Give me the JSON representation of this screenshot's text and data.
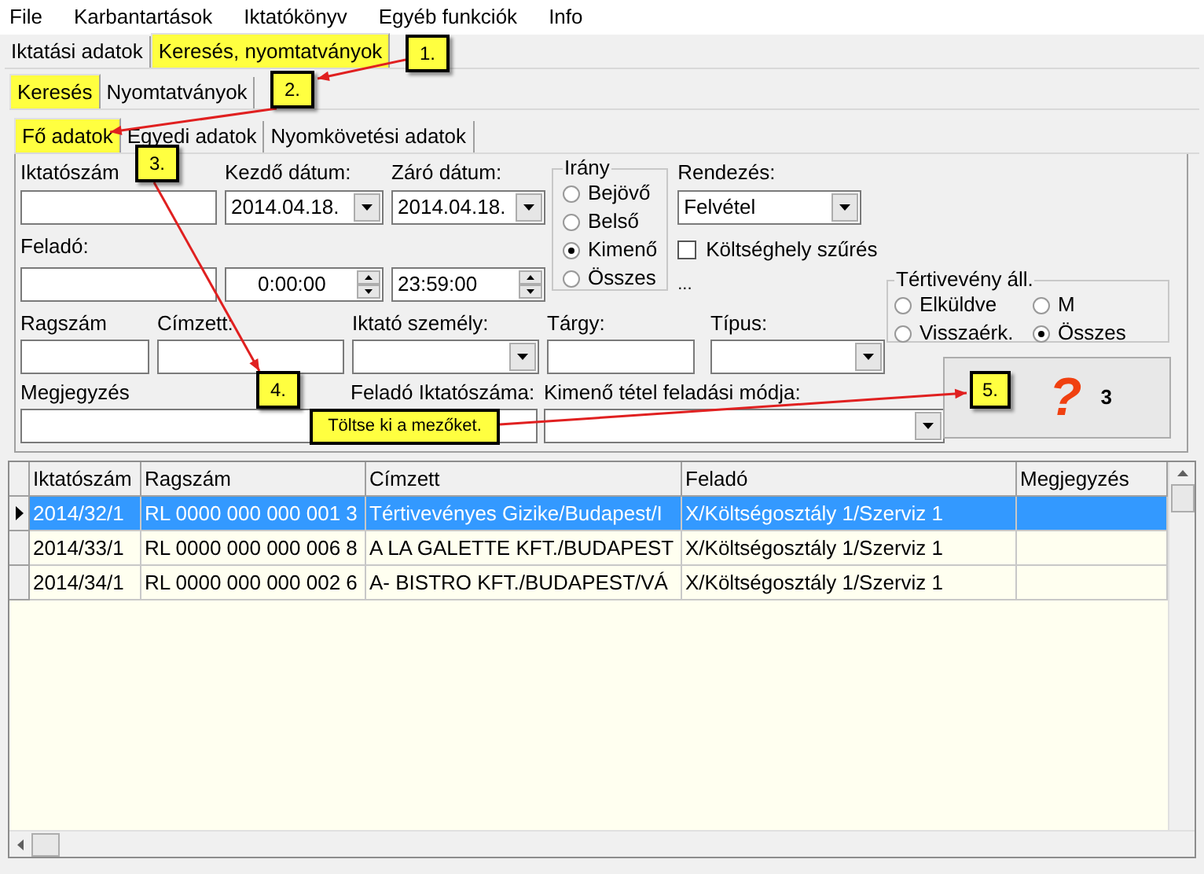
{
  "menu": [
    "File",
    "Karbantartások",
    "Iktatókönyv",
    "Egyéb funkciók",
    "Info"
  ],
  "tabs_main": [
    {
      "label": "Iktatási adatok",
      "selected": false,
      "highlighted": false
    },
    {
      "label": "Keresés, nyomtatványok",
      "selected": true,
      "highlighted": true
    }
  ],
  "tabs_sub": [
    {
      "label": "Keresés",
      "selected": true,
      "highlighted": true
    },
    {
      "label": "Nyomtatványok",
      "selected": false,
      "highlighted": false
    }
  ],
  "tabs_form": [
    {
      "label": "Fő adatok",
      "selected": true,
      "highlighted": true
    },
    {
      "label": "Egyedi adatok",
      "selected": false,
      "highlighted": false
    },
    {
      "label": "Nyomkövetési adatok",
      "selected": false,
      "highlighted": false
    }
  ],
  "form": {
    "iktatoszam": {
      "label": "Iktatószám"
    },
    "kezdo_datum": {
      "label": "Kezdő dátum:",
      "value": "2014.04.18."
    },
    "zaro_datum": {
      "label": "Záró dátum:",
      "value": "2014.04.18."
    },
    "felado": {
      "label": "Feladó:"
    },
    "kezdo_ido": {
      "value": "0:00:00"
    },
    "zaro_ido": {
      "value": "23:59:00"
    },
    "irany": {
      "title": "Irány",
      "options": [
        {
          "label": "Bejövő",
          "selected": false
        },
        {
          "label": "Belső",
          "selected": false
        },
        {
          "label": "Kimenő",
          "selected": true
        },
        {
          "label": "Összes",
          "selected": false
        }
      ]
    },
    "rendezes": {
      "label": "Rendezés:",
      "value": "Felvétel"
    },
    "koltseghely": {
      "label": "Költséghely szűrés",
      "checked": false
    },
    "more": "...",
    "tertiveveny": {
      "title": "Tértivevény áll.",
      "options": [
        {
          "label": "Elküldve",
          "selected": false
        },
        {
          "label": "M",
          "selected": false
        },
        {
          "label": "Visszaérk.",
          "selected": false
        },
        {
          "label": "Összes",
          "selected": true
        }
      ]
    },
    "ragszam": {
      "label": "Ragszám"
    },
    "cimzett": {
      "label": "Címzett:"
    },
    "iktato_szemely": {
      "label": "Iktató személy:"
    },
    "targy": {
      "label": "Tárgy:"
    },
    "tipus": {
      "label": "Típus:"
    },
    "megjegyzes": {
      "label": "Megjegyzés"
    },
    "felado_iktatoszama": {
      "label": "Feladó Iktatószáma:"
    },
    "feladasi_mod": {
      "label": "Kimenő tétel feladási módja:"
    },
    "search_button": {
      "icon": "?",
      "count": "3"
    }
  },
  "grid": {
    "columns": [
      "Iktatószám",
      "Ragszám",
      "Címzett",
      "Feladó",
      "Megjegyzés"
    ],
    "rows": [
      {
        "selected": true,
        "cells": [
          "2014/32/1",
          "RL 0000 000 000 001 3",
          "Tértivevényes Gizike/Budapest/I",
          "X/Költségosztály 1/Szerviz 1",
          ""
        ]
      },
      {
        "selected": false,
        "cells": [
          "2014/33/1",
          "RL 0000 000 000 006 8",
          "A LA GALETTE KFT./BUDAPEST",
          "X/Költségosztály 1/Szerviz 1",
          ""
        ]
      },
      {
        "selected": false,
        "cells": [
          "2014/34/1",
          "RL 0000 000 000 002 6",
          "A- BISTRO KFT./BUDAPEST/VÁ",
          "X/Költségosztály 1/Szerviz 1",
          ""
        ]
      }
    ]
  },
  "annotations": {
    "callouts": [
      "1.",
      "2.",
      "3.",
      "4.",
      "5."
    ],
    "tooltip": "Töltse ki a mezőket."
  }
}
